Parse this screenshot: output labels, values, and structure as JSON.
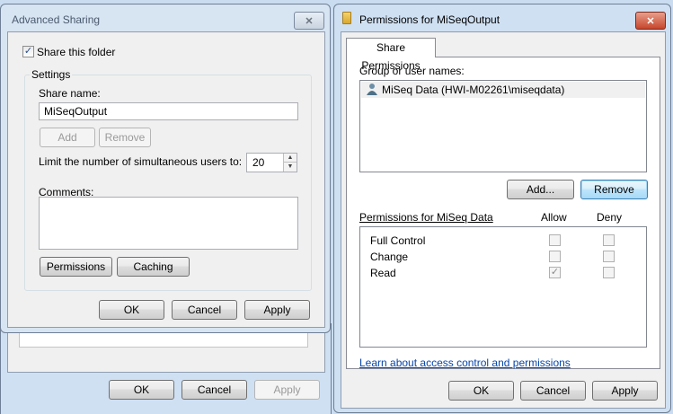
{
  "advanced_sharing": {
    "title": "Advanced Sharing",
    "close_glyph": "✕",
    "share_checkbox_label": "Share this folder",
    "share_checked": true,
    "settings_group": "Settings",
    "share_name_label": "Share name:",
    "share_name_value": "MiSeqOutput",
    "add_label": "Add",
    "remove_label": "Remove",
    "limit_label": "Limit the number of simultaneous users to:",
    "limit_value": "20",
    "comments_label": "Comments:",
    "comments_value": "",
    "permissions_label": "Permissions",
    "caching_label": "Caching",
    "ok_label": "OK",
    "cancel_label": "Cancel",
    "apply_label": "Apply"
  },
  "background_dialog": {
    "ok_label": "OK",
    "cancel_label": "Cancel",
    "apply_label": "Apply"
  },
  "permissions_dialog": {
    "title": "Permissions for MiSeqOutput",
    "close_glyph": "✕",
    "tab_label": "Share Permissions",
    "group_label": "Group or user names:",
    "users": [
      {
        "name": "MiSeq Data (HWI-M02261\\miseqdata)",
        "icon": "user-icon"
      }
    ],
    "add_label": "Add...",
    "remove_label": "Remove",
    "perm_header": "Permissions for MiSeq Data",
    "allow_header": "Allow",
    "deny_header": "Deny",
    "permissions": [
      {
        "name": "Full Control",
        "allow": false,
        "deny": false
      },
      {
        "name": "Change",
        "allow": false,
        "deny": false
      },
      {
        "name": "Read",
        "allow": true,
        "deny": false
      }
    ],
    "learn_link": "Learn about access control and permissions",
    "ok_label": "OK",
    "cancel_label": "Cancel",
    "apply_label": "Apply"
  }
}
